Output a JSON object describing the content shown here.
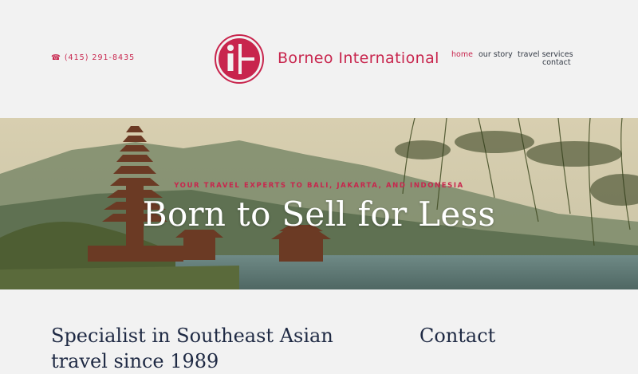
{
  "header": {
    "phone": "☎ (415) 291-8435",
    "brand_name": "Borneo International",
    "logo_icon": "bi-circle-logo-icon",
    "nav": [
      {
        "label": "home",
        "active": true
      },
      {
        "label": "our story",
        "active": false
      },
      {
        "label": "travel services",
        "active": false
      },
      {
        "label": "contact",
        "active": false
      }
    ]
  },
  "hero": {
    "tagline": "YOUR TRAVEL EXPERTS TO BALI, JAKARTA, AND INDONESIA",
    "headline": "Born to Sell for Less"
  },
  "content": {
    "intro_heading": "Specialist in Southeast Asian travel since 1989",
    "contact_heading": "Contact"
  },
  "colors": {
    "accent": "#c8254d",
    "heading": "#1f2a44",
    "background": "#f2f2f2"
  }
}
